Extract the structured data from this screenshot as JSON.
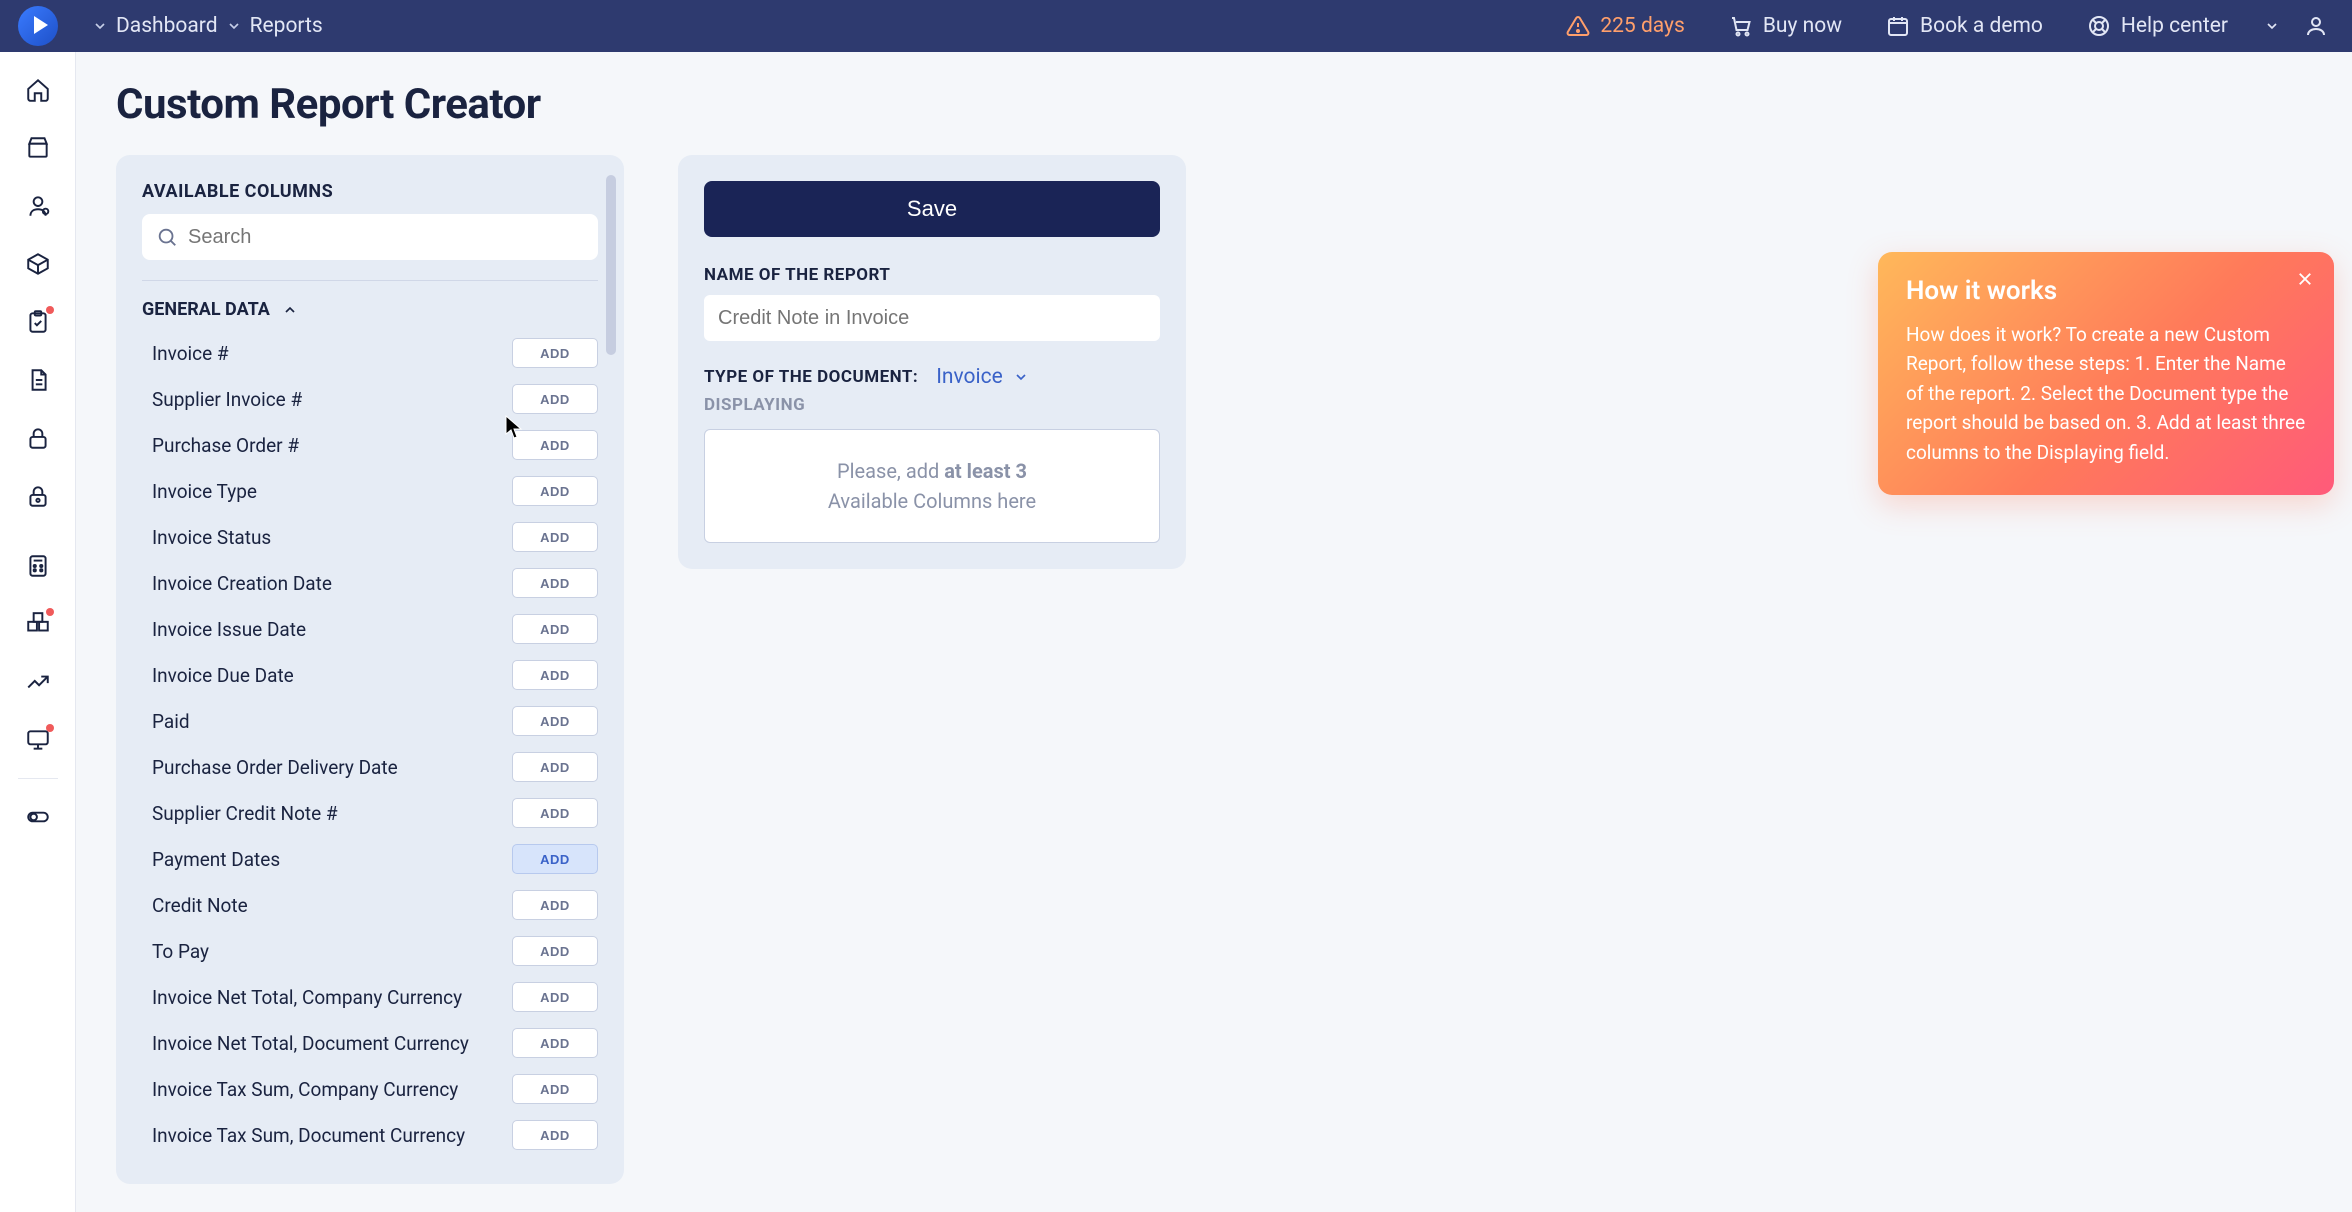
{
  "topbar": {
    "crumbs": [
      "Dashboard",
      "Reports"
    ],
    "trial": "225 days",
    "buy": "Buy now",
    "demo": "Book a demo",
    "help": "Help center"
  },
  "page": {
    "title": "Custom Report Creator"
  },
  "available": {
    "heading": "AVAILABLE COLUMNS",
    "search_placeholder": "Search",
    "group_label": "GENERAL DATA",
    "add_label": "ADD",
    "columns": [
      "Invoice #",
      "Supplier Invoice #",
      "Purchase Order #",
      "Invoice Type",
      "Invoice Status",
      "Invoice Creation Date",
      "Invoice Issue Date",
      "Invoice Due Date",
      "Paid",
      "Purchase Order Delivery Date",
      "Supplier Credit Note #",
      "Payment Dates",
      "Credit Note",
      "To Pay",
      "Invoice Net Total, Company Currency",
      "Invoice Net Total, Document Currency",
      "Invoice Tax Sum, Company Currency",
      "Invoice Tax Sum, Document Currency"
    ],
    "hovered_index": 11
  },
  "config": {
    "save_label": "Save",
    "name_label": "NAME OF THE REPORT",
    "name_placeholder": "Credit Note in Invoice",
    "doc_type_label": "TYPE OF THE DOCUMENT:",
    "doc_type_value": "Invoice",
    "displaying_label": "DISPLAYING",
    "dropzone_prefix": "Please, add ",
    "dropzone_bold": "at least 3",
    "dropzone_suffix": "Available Columns here"
  },
  "tip": {
    "title": "How it works",
    "body": "How does it work? To create a new Custom Report, follow these steps: 1. Enter the Name of the report. 2. Select the Document type the report should be based on. 3. Add at least three columns to the Displaying field."
  },
  "sidebar_icons": [
    "home-icon",
    "cart-icon",
    "supplier-icon",
    "box-icon",
    "clipboard-icon",
    "document-icon",
    "lock-icon",
    "lock-group-icon",
    "calculator-icon",
    "inventory-icon",
    "chart-icon",
    "monitor-icon",
    "switch-icon"
  ]
}
